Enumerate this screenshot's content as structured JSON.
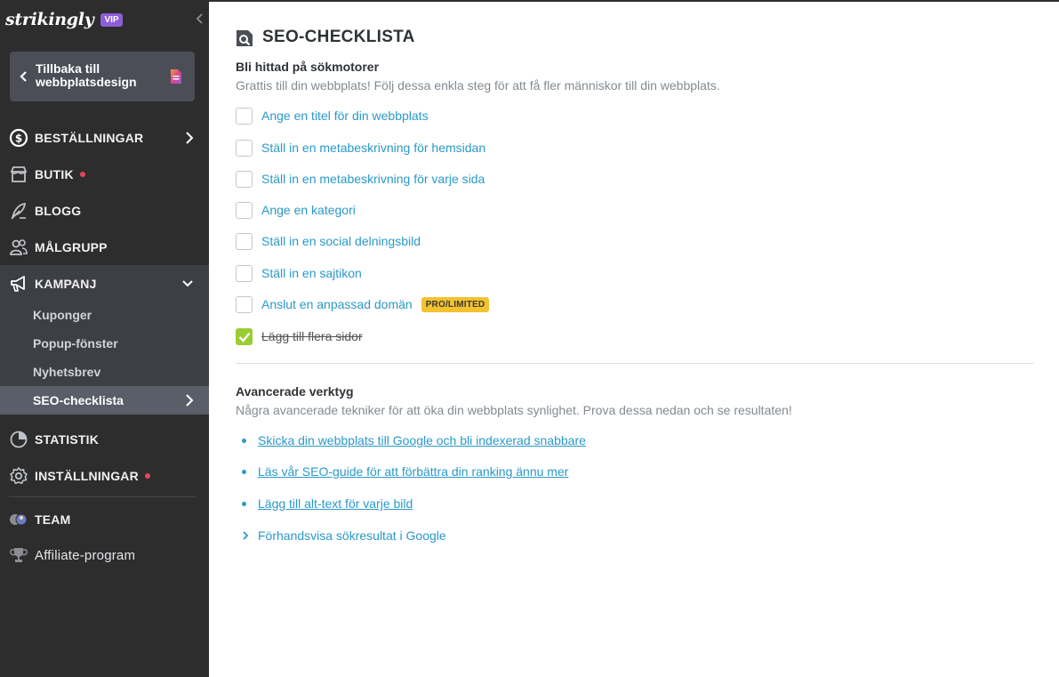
{
  "sidebar": {
    "logo": "strikingly",
    "vip_badge": "VIP",
    "back_button": "Tillbaka till webbplatsdesign",
    "nav": {
      "orders": "BESTÄLLNINGAR",
      "shop": "BUTIK",
      "blog": "BLOGG",
      "audience": "MÅLGRUPP",
      "campaign": "KAMPANJ",
      "statistics": "STATISTIK",
      "settings": "INSTÄLLNINGAR",
      "team": "TEAM",
      "affiliate": "Affiliate-program"
    },
    "campaign_items": [
      "Kuponger",
      "Popup-fönster",
      "Nyhetsbrev",
      "SEO-checklista"
    ],
    "active_item": "SEO-checklista"
  },
  "main": {
    "title": "SEO-CHECKLISTA",
    "section1": {
      "title": "Bli hittad på sökmotorer",
      "description": "Grattis till din webbplats! Följ dessa enkla steg för att få fler människor till din webbplats.",
      "items": [
        {
          "label": "Ange en titel för din webbplats",
          "checked": false
        },
        {
          "label": "Ställ in en metabeskrivning för hemsidan",
          "checked": false
        },
        {
          "label": "Ställ in en metabeskrivning för varje sida",
          "checked": false
        },
        {
          "label": "Ange en kategori",
          "checked": false
        },
        {
          "label": "Ställ in en social delningsbild",
          "checked": false
        },
        {
          "label": "Ställ in en sajtikon",
          "checked": false
        },
        {
          "label": "Anslut en anpassad domän",
          "checked": false,
          "badge": "PRO/LIMITED"
        },
        {
          "label": "Lägg till flera sidor",
          "checked": true
        }
      ]
    },
    "section2": {
      "title": "Avancerade verktyg",
      "description": "Några avancerade tekniker för att öka din webbplats synlighet. Prova dessa nedan och se resultaten!",
      "links": [
        "Skicka din webbplats till Google och bli indexerad snabbare",
        "Läs vår SEO-guide för att förbättra din ranking ännu mer",
        "Lägg till alt-text för varje bild"
      ],
      "preview": "Förhandsvisa sökresultat i Google"
    }
  },
  "colors": {
    "sidebar_bg": "#2d2d2d",
    "sidebar_group_bg": "#3d3f45",
    "active_bg": "#5a5e68",
    "link": "#2a99c8",
    "check": "#9acd32",
    "badge": "#f2c230",
    "vip": "#8e5cd9",
    "notification_dot": "#e8455a"
  }
}
